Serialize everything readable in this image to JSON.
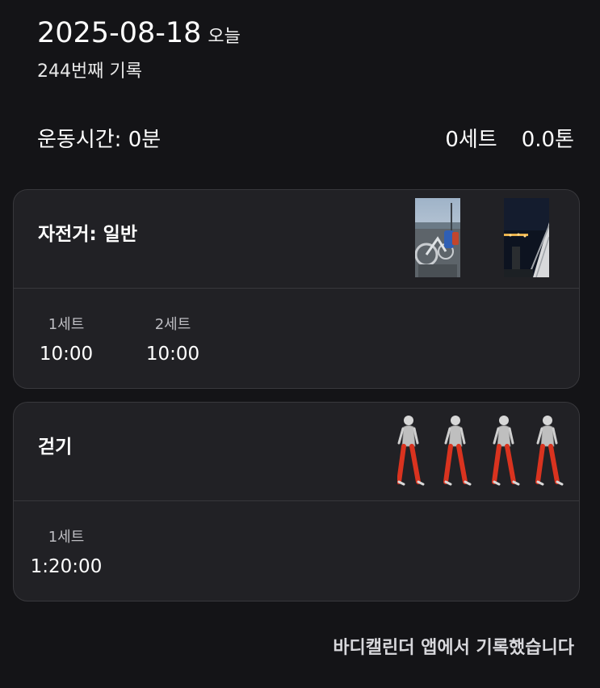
{
  "header": {
    "date": "2025-08-18",
    "today_label": "오늘",
    "record_count": "244번째 기록"
  },
  "summary": {
    "duration": "운동시간: 0분",
    "sets": "0세트",
    "tonnage": "0.0톤"
  },
  "exercises": [
    {
      "name": "자전거: 일반",
      "sets": [
        {
          "label": "1세트",
          "value": "10:00"
        },
        {
          "label": "2세트",
          "value": "10:00"
        }
      ]
    },
    {
      "name": "걷기",
      "sets": [
        {
          "label": "1세트",
          "value": "1:20:00"
        }
      ]
    }
  ],
  "footer": {
    "note": "바디캘린더 앱에서 기록했습니다"
  },
  "colors": {
    "background": "#141417",
    "card": "#212125",
    "divider": "#38383c",
    "muscle_highlight": "#d9331f"
  }
}
